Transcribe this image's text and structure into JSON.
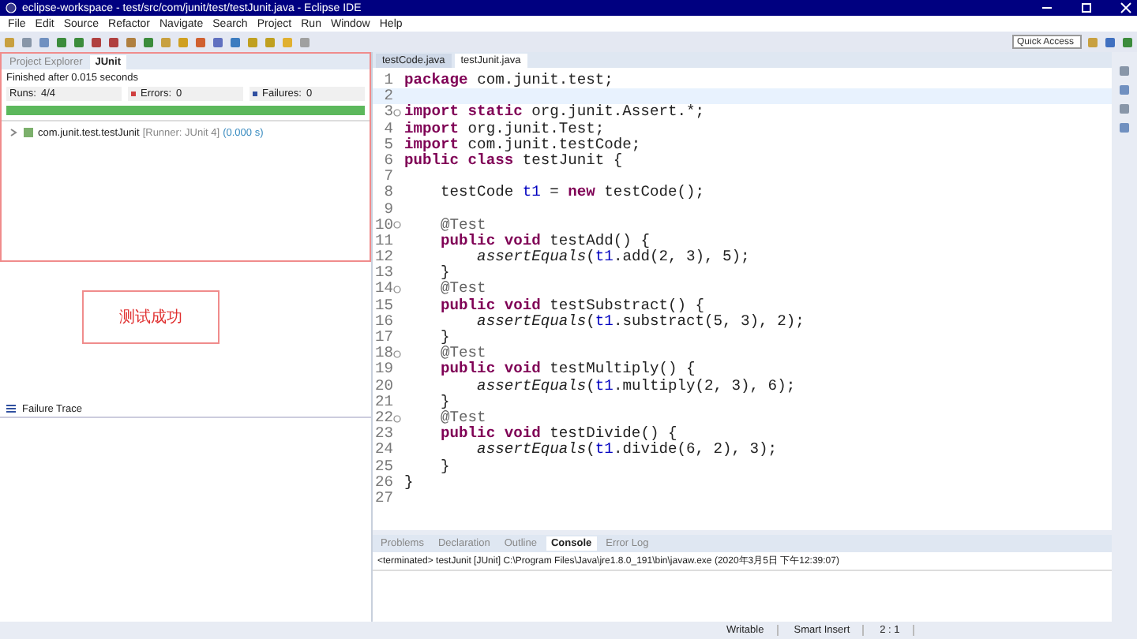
{
  "window": {
    "title": "eclipse-workspace - test/src/com/junit/test/testJunit.java - Eclipse IDE"
  },
  "menu": [
    "File",
    "Edit",
    "Source",
    "Refactor",
    "Navigate",
    "Search",
    "Project",
    "Run",
    "Window",
    "Help"
  ],
  "quick_access": {
    "placeholder": "Quick Access"
  },
  "left_views": [
    {
      "label": "Project Explorer",
      "selected": false
    },
    {
      "label": "JUnit",
      "selected": true
    }
  ],
  "junit": {
    "status": "Finished after 0.015 seconds",
    "counters": [
      {
        "kind": "runs",
        "label": "Runs:",
        "value": "4/4"
      },
      {
        "kind": "errors",
        "label": "Errors:",
        "value": "0"
      },
      {
        "kind": "failures",
        "label": "Failures:",
        "value": "0"
      }
    ],
    "progress": {
      "level": 1
    },
    "tree": [
      {
        "name": "com.junit.test.testJunit",
        "runner": "[Runner: JUnit 4]",
        "time": "(0.000 s)",
        "expanded": false
      }
    ]
  },
  "note": "测试成功",
  "failure_trace": {
    "title": "Failure Trace"
  },
  "editor": {
    "tabs": [
      {
        "label": "testCode.java",
        "selected": false
      },
      {
        "label": "testJunit.java",
        "selected": true
      }
    ],
    "lines": [
      {
        "n": "1",
        "tokens": [
          {
            "kind": "keyword",
            "text": "package"
          },
          {
            "kind": "plain",
            "text": " com.junit.test;"
          }
        ]
      },
      {
        "n": "2",
        "current": true
      },
      {
        "n": "3",
        "fold": true,
        "tokens": [
          {
            "kind": "keyword",
            "text": "import static"
          },
          {
            "kind": "plain",
            "text": " org.junit.Assert.*;"
          }
        ]
      },
      {
        "n": "4",
        "tokens": [
          {
            "kind": "keyword",
            "text": "import"
          },
          {
            "kind": "plain",
            "text": " org.junit.Test;"
          }
        ]
      },
      {
        "n": "5",
        "tokens": [
          {
            "kind": "keyword",
            "text": "import"
          },
          {
            "kind": "plain",
            "text": " com.junit.testCode;"
          }
        ]
      },
      {
        "n": "6",
        "tokens": [
          {
            "kind": "keyword",
            "text": "public class"
          },
          {
            "kind": "plain",
            "text": " testJunit {"
          }
        ]
      },
      {
        "n": "7"
      },
      {
        "n": "8",
        "tokens": [
          {
            "kind": "plain",
            "text": "    testCode "
          },
          {
            "kind": "field",
            "text": "t1"
          },
          {
            "kind": "plain",
            "text": " = "
          },
          {
            "kind": "keyword",
            "text": "new"
          },
          {
            "kind": "plain",
            "text": " testCode();"
          }
        ]
      },
      {
        "n": "9"
      },
      {
        "n": "10",
        "fold": true,
        "tokens": [
          {
            "kind": "annotation",
            "text": "    @Test"
          }
        ]
      },
      {
        "n": "11",
        "tokens": [
          {
            "kind": "keyword",
            "text": "    public void"
          },
          {
            "kind": "plain",
            "text": " testAdd() {"
          }
        ]
      },
      {
        "n": "12",
        "tokens": [
          {
            "kind": "static-call",
            "text": "        assertEquals"
          },
          {
            "kind": "plain",
            "text": "("
          },
          {
            "kind": "field",
            "text": "t1"
          },
          {
            "kind": "plain",
            "text": ".add(2, 3), 5);"
          }
        ]
      },
      {
        "n": "13",
        "tokens": [
          {
            "kind": "plain",
            "text": "    }"
          }
        ]
      },
      {
        "n": "14",
        "fold": true,
        "tokens": [
          {
            "kind": "annotation",
            "text": "    @Test"
          }
        ]
      },
      {
        "n": "15",
        "tokens": [
          {
            "kind": "keyword",
            "text": "    public void"
          },
          {
            "kind": "plain",
            "text": " testSubstract() {"
          }
        ]
      },
      {
        "n": "16",
        "tokens": [
          {
            "kind": "static-call",
            "text": "        assertEquals"
          },
          {
            "kind": "plain",
            "text": "("
          },
          {
            "kind": "field",
            "text": "t1"
          },
          {
            "kind": "plain",
            "text": ".substract(5, 3), 2);"
          }
        ]
      },
      {
        "n": "17",
        "tokens": [
          {
            "kind": "plain",
            "text": "    }"
          }
        ]
      },
      {
        "n": "18",
        "fold": true,
        "tokens": [
          {
            "kind": "annotation",
            "text": "    @Test"
          }
        ]
      },
      {
        "n": "19",
        "tokens": [
          {
            "kind": "keyword",
            "text": "    public void"
          },
          {
            "kind": "plain",
            "text": " testMultiply() {"
          }
        ]
      },
      {
        "n": "20",
        "tokens": [
          {
            "kind": "static-call",
            "text": "        assertEquals"
          },
          {
            "kind": "plain",
            "text": "("
          },
          {
            "kind": "field",
            "text": "t1"
          },
          {
            "kind": "plain",
            "text": ".multiply(2, 3), 6);"
          }
        ]
      },
      {
        "n": "21",
        "tokens": [
          {
            "kind": "plain",
            "text": "    }"
          }
        ]
      },
      {
        "n": "22",
        "fold": true,
        "tokens": [
          {
            "kind": "annotation",
            "text": "    @Test"
          }
        ]
      },
      {
        "n": "23",
        "tokens": [
          {
            "kind": "keyword",
            "text": "    public void"
          },
          {
            "kind": "plain",
            "text": " testDivide() {"
          }
        ]
      },
      {
        "n": "24",
        "tokens": [
          {
            "kind": "static-call",
            "text": "        assertEquals"
          },
          {
            "kind": "plain",
            "text": "("
          },
          {
            "kind": "field",
            "text": "t1"
          },
          {
            "kind": "plain",
            "text": ".divide(6, 2), 3);"
          }
        ]
      },
      {
        "n": "25",
        "tokens": [
          {
            "kind": "plain",
            "text": "    }"
          }
        ]
      },
      {
        "n": "26",
        "tokens": [
          {
            "kind": "plain",
            "text": "}"
          }
        ]
      },
      {
        "n": "27"
      }
    ]
  },
  "bottom_views": [
    {
      "label": "Problems",
      "selected": false
    },
    {
      "label": "Declaration",
      "selected": false
    },
    {
      "label": "Outline",
      "selected": false
    },
    {
      "label": "Console",
      "selected": true
    },
    {
      "label": "Error Log",
      "selected": false
    }
  ],
  "console": {
    "header": "<terminated> testJunit [JUnit] C:\\Program Files\\Java\\jre1.8.0_191\\bin\\javaw.exe (2020年3月5日 下午12:39:07)"
  },
  "status_bar": [
    "Writable",
    "Smart Insert",
    "2 : 1"
  ]
}
